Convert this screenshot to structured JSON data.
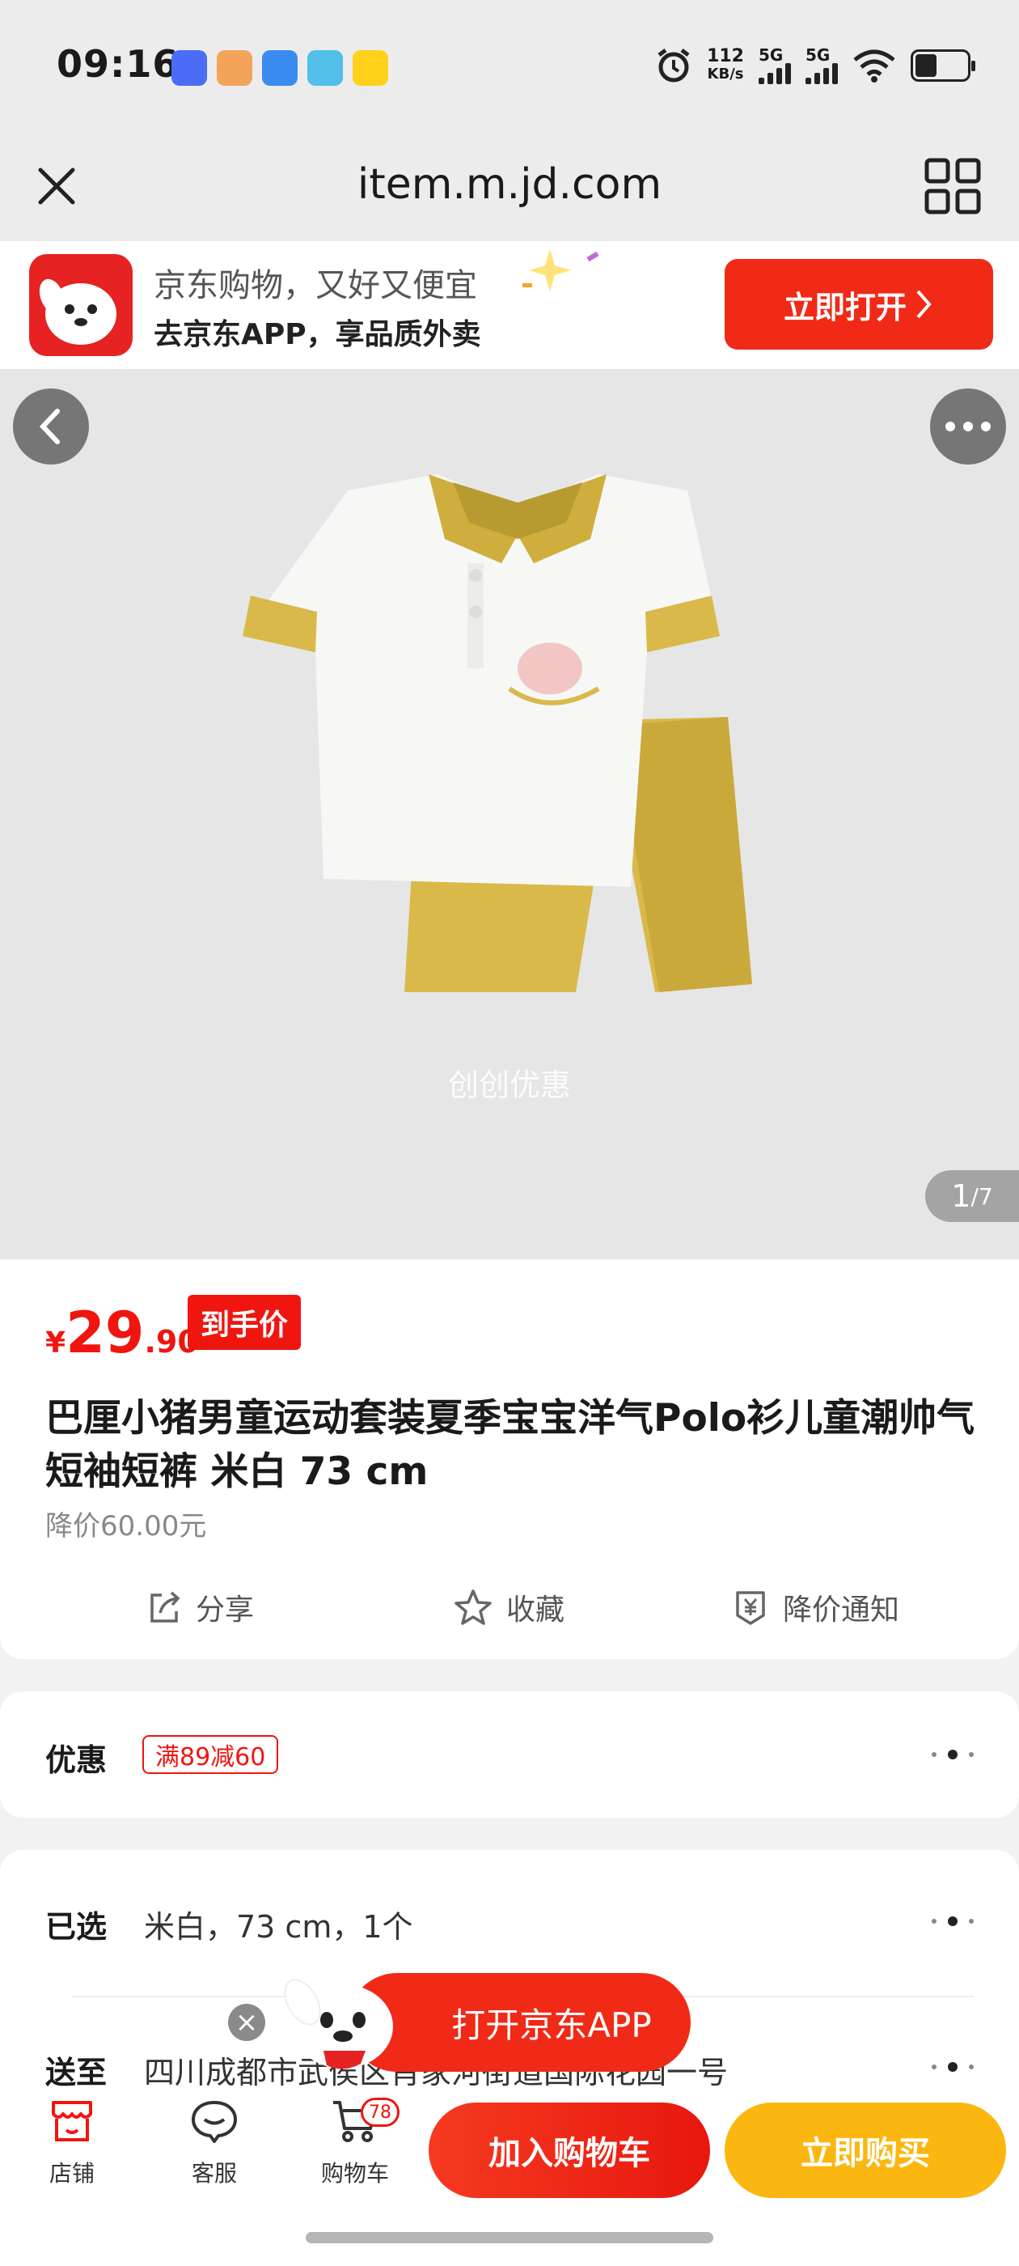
{
  "status_bar": {
    "time": "09:16",
    "net_speed_value": "112",
    "net_speed_unit": "KB/s",
    "signal1_label": "5G",
    "signal2_label": "5G",
    "app_icons": [
      "vivo",
      "meme",
      "baidu",
      "telegram",
      "美团"
    ]
  },
  "browser": {
    "url": "item.m.jd.com"
  },
  "banner": {
    "line1": "京东购物，又好又便宜",
    "line2": "去京东APP，享品质外卖",
    "open_button": "立即打开"
  },
  "gallery": {
    "watermark": "创创优惠",
    "current": "1",
    "total": "/7"
  },
  "product": {
    "currency": "¥",
    "price_int": "29",
    "price_dec": ".90",
    "price_tag": "到手价",
    "title": "巴厘小猪男童运动套装夏季宝宝洋气Polo衫儿童潮帅气短袖短裤 米白 73 cm",
    "price_drop": "降价60.00元",
    "actions": {
      "share": "分享",
      "favorite": "收藏",
      "price_alert": "降价通知"
    }
  },
  "promo": {
    "label": "优惠",
    "coupon": "满89减60"
  },
  "selection": {
    "label": "已选",
    "value": "米白，73 cm，1个",
    "ship_label": "送至",
    "ship_value": "四川成都市武侯区肖家河街道国际花园一号"
  },
  "floating": {
    "open_app": "打开京东APP"
  },
  "bottom_nav": {
    "store": "店铺",
    "service": "客服",
    "cart": "购物车",
    "cart_count": "78",
    "add_to_cart": "加入购物车",
    "buy_now": "立即购买"
  },
  "colors": {
    "brand_red": "#f0150f",
    "buy_yellow": "#fbb70f"
  }
}
